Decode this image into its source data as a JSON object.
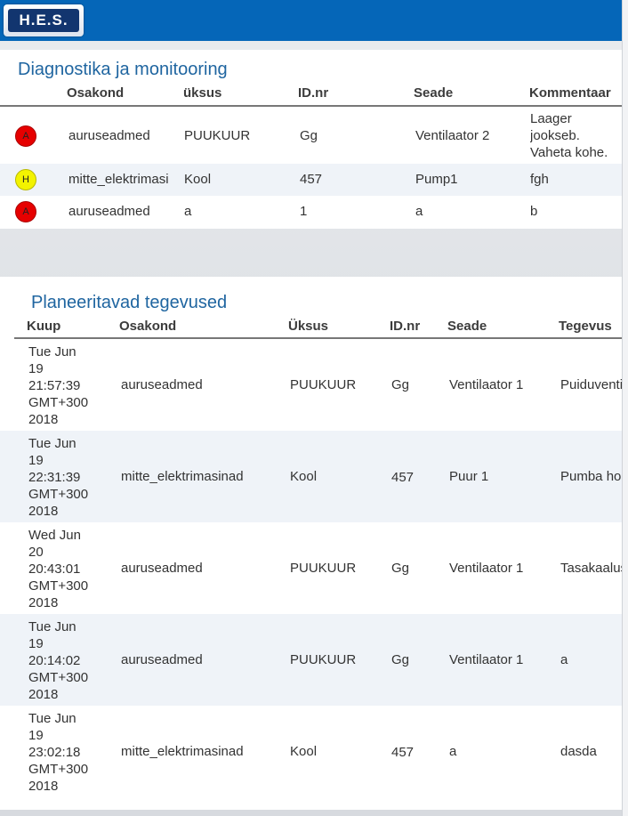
{
  "header": {
    "logo_text": "H.E.S.",
    "bar_color": "#0566b8"
  },
  "diagnostics": {
    "title": "Diagnostika ja monitooring",
    "columns": [
      "Osakond",
      "üksus",
      "ID.nr",
      "Seade",
      "Kommentaar"
    ],
    "rows": [
      {
        "status": "A",
        "status_color": "#e60000",
        "osakond": "auruseadmed",
        "uksus": "PUUKUUR",
        "idnr": "Gg",
        "seade": "Ventilaator 2",
        "kommentaar": "Laager jookseb. Vaheta kohe."
      },
      {
        "status": "H",
        "status_color": "#f3f300",
        "osakond": "mitte_elektrimasinad",
        "uksus": "Kool",
        "idnr": "457",
        "seade": "Pump1",
        "kommentaar": "fgh"
      },
      {
        "status": "A",
        "status_color": "#e60000",
        "osakond": "auruseadmed",
        "uksus": "a",
        "idnr": "1",
        "seade": "a",
        "kommentaar": "b"
      }
    ]
  },
  "planned": {
    "title": "Planeeritavad tegevused",
    "columns": [
      "Kuup",
      "Osakond",
      "Üksus",
      "ID.nr",
      "Seade",
      "Tegevus"
    ],
    "rows": [
      {
        "kuup": [
          "Tue Jun",
          "19",
          "21:57:39",
          "GMT+300",
          "2018"
        ],
        "osakond": "auruseadmed",
        "uksus": "PUUKUUR",
        "idnr": "Gg",
        "seade": "Ventilaator 1",
        "tegevus": "Puiduventilaator"
      },
      {
        "kuup": [
          "Tue Jun",
          "19",
          "22:31:39",
          "GMT+300",
          "2018"
        ],
        "osakond": "mitte_elektrimasinad",
        "uksus": "Kool",
        "idnr": "457",
        "seade": "Puur 1",
        "tegevus": "Pumba hooldus"
      },
      {
        "kuup": [
          "Wed Jun",
          "20",
          "20:43:01",
          "GMT+300",
          "2018"
        ],
        "osakond": "auruseadmed",
        "uksus": "PUUKUUR",
        "idnr": "Gg",
        "seade": "Ventilaator 1",
        "tegevus": "Tasakaalustamine"
      },
      {
        "kuup": [
          "Tue Jun",
          "19",
          "20:14:02",
          "GMT+300",
          "2018"
        ],
        "osakond": "auruseadmed",
        "uksus": "PUUKUUR",
        "idnr": "Gg",
        "seade": "Ventilaator 1",
        "tegevus": "a"
      },
      {
        "kuup": [
          "Tue Jun",
          "19",
          "23:02:18",
          "GMT+300",
          "2018"
        ],
        "osakond": "mitte_elektrimasinad",
        "uksus": "Kool",
        "idnr": "457",
        "seade": "a",
        "tegevus": "dasda"
      }
    ]
  }
}
